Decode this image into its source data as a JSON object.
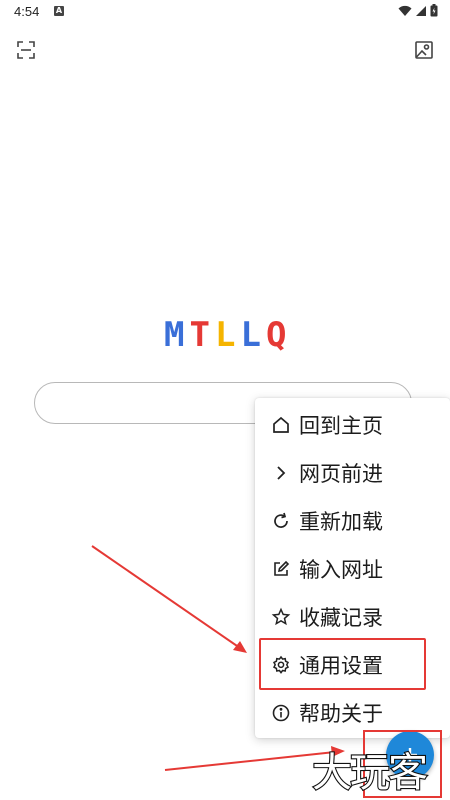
{
  "status_bar": {
    "time": "4:54",
    "notification_icon": "a-badge-icon",
    "icons": [
      "wifi-icon",
      "signal-icon",
      "battery-icon"
    ]
  },
  "toolbar": {
    "left_icon": "scan-icon",
    "right_icon": "image-icon"
  },
  "logo": {
    "letters": [
      {
        "char": "M",
        "color": "#3a6fd8"
      },
      {
        "char": "T",
        "color": "#e53935"
      },
      {
        "char": "L",
        "color": "#f5b400"
      },
      {
        "char": "L",
        "color": "#3a6fd8"
      },
      {
        "char": "Q",
        "color": "#e53935"
      }
    ]
  },
  "search": {
    "value": "",
    "placeholder": ""
  },
  "menu": {
    "items": [
      {
        "label": "回到主页",
        "icon": "home-icon"
      },
      {
        "label": "网页前进",
        "icon": "chevron-right-icon"
      },
      {
        "label": "重新加载",
        "icon": "reload-icon"
      },
      {
        "label": "输入网址",
        "icon": "edit-icon"
      },
      {
        "label": "收藏记录",
        "icon": "star-icon"
      },
      {
        "label": "通用设置",
        "icon": "gear-icon",
        "highlighted": true
      },
      {
        "label": "帮助关于",
        "icon": "info-icon"
      }
    ]
  },
  "fab": {
    "icon": "plus-icon",
    "color": "#1f88d9"
  },
  "annotations": {
    "highlight_color": "#e53935"
  },
  "watermark": {
    "text": "大玩客"
  }
}
